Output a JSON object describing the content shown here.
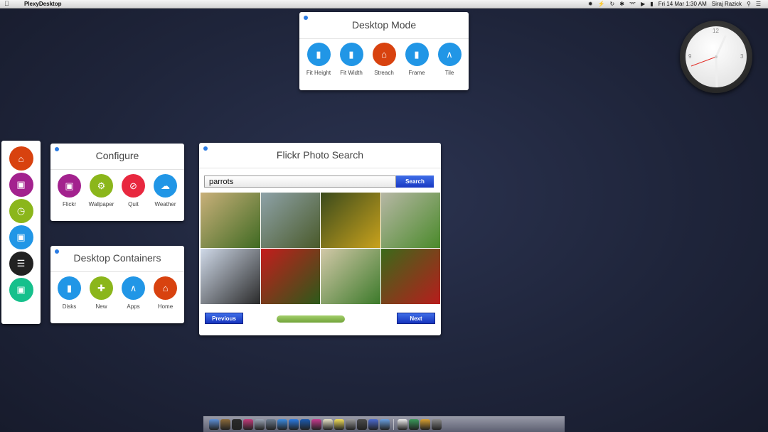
{
  "menubar": {
    "app_name": "PlexyDesktop",
    "datetime": "Fri 14 Mar  1:30 AM",
    "user": "Siraj Razick",
    "icons": [
      "plexy-icon",
      "bolt-icon",
      "timemachine-icon",
      "bluetooth-icon",
      "wifi-icon",
      "volume-icon",
      "battery-icon",
      "search-icon",
      "list-icon"
    ]
  },
  "desktop_mode": {
    "title": "Desktop Mode",
    "buttons": [
      {
        "label": "Fit Height",
        "icon": "disk-icon",
        "color": "#2196e6"
      },
      {
        "label": "Fit Width",
        "icon": "disk-icon",
        "color": "#2196e6"
      },
      {
        "label": "Streach",
        "icon": "home-icon",
        "color": "#d8420f"
      },
      {
        "label": "Frame",
        "icon": "disk-icon",
        "color": "#2196e6"
      },
      {
        "label": "Tile",
        "icon": "appstore-icon",
        "color": "#2196e6"
      }
    ]
  },
  "configure": {
    "title": "Configure",
    "buttons": [
      {
        "label": "Flickr",
        "icon": "image-icon",
        "color": "#a3228e"
      },
      {
        "label": "Wallpaper",
        "icon": "gear-icon",
        "color": "#8bb61b"
      },
      {
        "label": "Quit",
        "icon": "quit-icon",
        "color": "#e8283f"
      },
      {
        "label": "Weather",
        "icon": "cloud-icon",
        "color": "#2196e6"
      }
    ]
  },
  "containers": {
    "title": "Desktop Containers",
    "buttons": [
      {
        "label": "Disks",
        "icon": "disk-icon",
        "color": "#2196e6"
      },
      {
        "label": "New",
        "icon": "plus-icon",
        "color": "#8bb61b"
      },
      {
        "label": "Apps",
        "icon": "appstore-icon",
        "color": "#2196e6"
      },
      {
        "label": "Home",
        "icon": "home-icon",
        "color": "#d8420f"
      }
    ]
  },
  "sidebar": {
    "items": [
      {
        "icon": "home-icon",
        "color": "#d8420f"
      },
      {
        "icon": "image-icon",
        "color": "#a3228e"
      },
      {
        "icon": "clock-icon",
        "color": "#8bb61b"
      },
      {
        "icon": "contact-icon",
        "color": "#2196e6"
      },
      {
        "icon": "list-icon",
        "color": "#222222"
      },
      {
        "icon": "folder-add-icon",
        "color": "#16c08c"
      }
    ]
  },
  "flickr": {
    "title": "Flickr Photo Search",
    "search_value": "parrots",
    "search_button": "Search",
    "previous_button": "Previous",
    "next_button": "Next",
    "progress": 1.0,
    "photos": [
      {
        "colors": [
          "#c9b07a",
          "#3f6a22"
        ]
      },
      {
        "colors": [
          "#8ea2a8",
          "#4a5a2a"
        ]
      },
      {
        "colors": [
          "#3a4a1c",
          "#c9a21c"
        ]
      },
      {
        "colors": [
          "#b7b7a5",
          "#4a8a2a"
        ]
      },
      {
        "colors": [
          "#cfd9e8",
          "#2a2a2a"
        ]
      },
      {
        "colors": [
          "#c41c1c",
          "#2c5a1a"
        ]
      },
      {
        "colors": [
          "#d2c8a8",
          "#3c7a2a"
        ]
      },
      {
        "colors": [
          "#3a6a1a",
          "#b81c1c"
        ]
      }
    ]
  },
  "clock": {
    "n12": "12",
    "n3": "3",
    "n9": "9"
  },
  "dock": {
    "icons": [
      "finder-icon",
      "preview-icon",
      "terminal-icon",
      "photos-icon",
      "safari-icon",
      "maps-icon",
      "appstore-icon",
      "downloads-icon",
      "globe-icon",
      "itunes-icon",
      "notes-icon",
      "stickies-icon",
      "settings-icon",
      "calculator-icon",
      "xcode-icon",
      "mail-icon",
      "calendar-icon",
      "maps-icon",
      "books-icon",
      "trash-icon"
    ]
  }
}
